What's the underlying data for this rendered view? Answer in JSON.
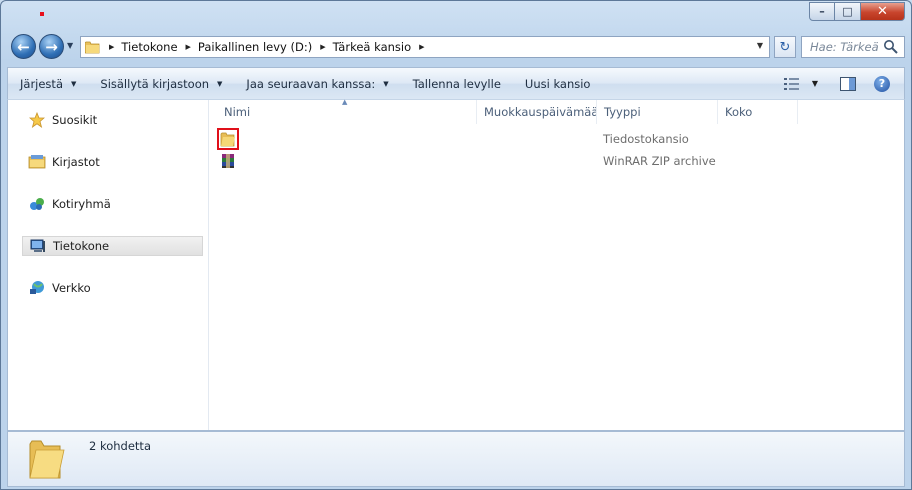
{
  "window": {
    "minimize_label": "–",
    "maximize_label": "□",
    "close_label": "✕"
  },
  "address": {
    "crumbs": [
      "Tietokone",
      "Paikallinen levy (D:)",
      "Tärkeä kansio"
    ]
  },
  "search": {
    "placeholder": "Hae: Tärkeä kansio"
  },
  "toolbar": {
    "organize": "Järjestä",
    "include_in_library": "Sisällytä kirjastoon",
    "share_with": "Jaa seuraavan kanssa:",
    "burn": "Tallenna levylle",
    "new_folder": "Uusi kansio"
  },
  "navigation": {
    "items": [
      {
        "label": "Suosikit",
        "icon": "star-icon"
      },
      {
        "label": "Kirjastot",
        "icon": "library-icon"
      },
      {
        "label": "Kotiryhmä",
        "icon": "homegroup-icon"
      },
      {
        "label": "Tietokone",
        "icon": "computer-icon",
        "selected": true
      },
      {
        "label": "Verkko",
        "icon": "network-icon"
      }
    ]
  },
  "columns": {
    "name": "Nimi",
    "modified": "Muokkauspäivämäärä",
    "type": "Tyyppi",
    "size": "Koko"
  },
  "files": [
    {
      "name": "",
      "type": "Tiedostokansio",
      "icon": "folder-icon"
    },
    {
      "name": "",
      "type": "WinRAR ZIP archive",
      "icon": "winrar-archive-icon"
    }
  ],
  "details": {
    "item_count": "2 kohdetta"
  },
  "colors": {
    "accent": "#2f6fb5",
    "highlight_border": "#e0101a",
    "folder": "#f2cf6a"
  }
}
